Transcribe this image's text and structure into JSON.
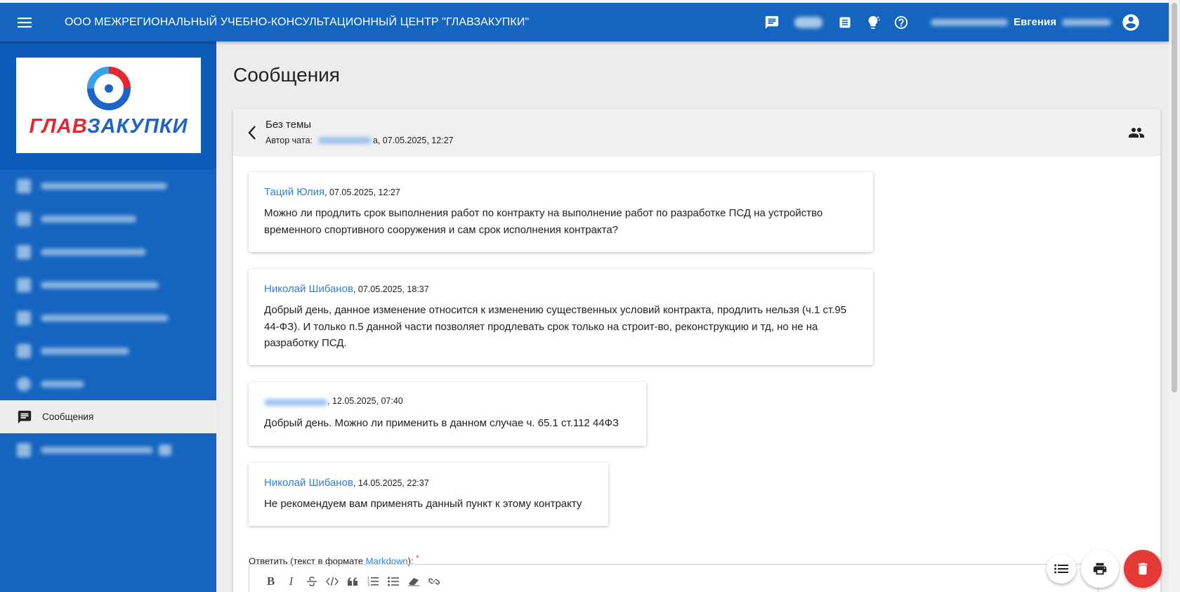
{
  "header": {
    "title": "ООО МЕЖРЕГИОНАЛЬНЫЙ УЧЕБНО-КОНСУЛЬТАЦИОННЫЙ ЦЕНТР \"ГЛАВЗАКУПКИ\"",
    "user_name": "Евгения",
    "icons": [
      "menu-icon",
      "chat-icon",
      "document-icon",
      "lightbulb-icon",
      "help-icon",
      "account-icon"
    ]
  },
  "logo": {
    "part_red": "ГЛАВ",
    "part_blue": "ЗАКУПКИ"
  },
  "sidebar": {
    "active_item": {
      "label": "Сообщения",
      "icon": "chat-icon"
    }
  },
  "page": {
    "title": "Сообщения"
  },
  "chat": {
    "topic": "Без темы",
    "author_label": "Автор чата:",
    "author_suffix": "а, 07.05.2025, 12:27"
  },
  "messages": [
    {
      "author": "Таций Юлия",
      "datetime": ", 07.05.2025, 12:27",
      "text": "Можно ли продлить срок выполнения работ по контракту на выполнение работ по разработке ПСД на устройство временного спортивного сооружения и сам срок исполнения контракта?"
    },
    {
      "author": "Николай Шибанов",
      "datetime": ", 07.05.2025, 18:37",
      "text": "Добрый день, данное изменение относится к изменению существенных условий контракта, продлить нельзя (ч.1 ст.95 44-ФЗ). И только п.5 данной части позволяет продлевать срок только на строит-во, реконструкцию и тд, но не на разработку ПСД."
    },
    {
      "author": "",
      "datetime": ", 12.05.2025, 07:40",
      "text": "Добрый день. Можно ли применить в данном случае ч. 65.1 ст.112 44ФЗ"
    },
    {
      "author": "Николай Шибанов",
      "datetime": ", 14.05.2025, 22:37",
      "text": "Не рекомендуем вам применять данный пункт к этому контракту"
    }
  ],
  "reply": {
    "label_prefix": "Ответить (текст в формате ",
    "link": "Markdown",
    "label_suffix": "):",
    "required_mark": "*",
    "toolbar": [
      "bold-icon",
      "italic-icon",
      "strikethrough-icon",
      "code-icon",
      "quote-icon",
      "ordered-list-icon",
      "unordered-list-icon",
      "eraser-icon",
      "link-icon"
    ],
    "bold": "B",
    "italic": "I"
  },
  "fabs": [
    "list-icon",
    "print-icon",
    "delete-icon"
  ],
  "colors": {
    "primary": "#1565c0",
    "link": "#2f80d1",
    "danger": "#e53935",
    "content_bg": "#ececec"
  }
}
